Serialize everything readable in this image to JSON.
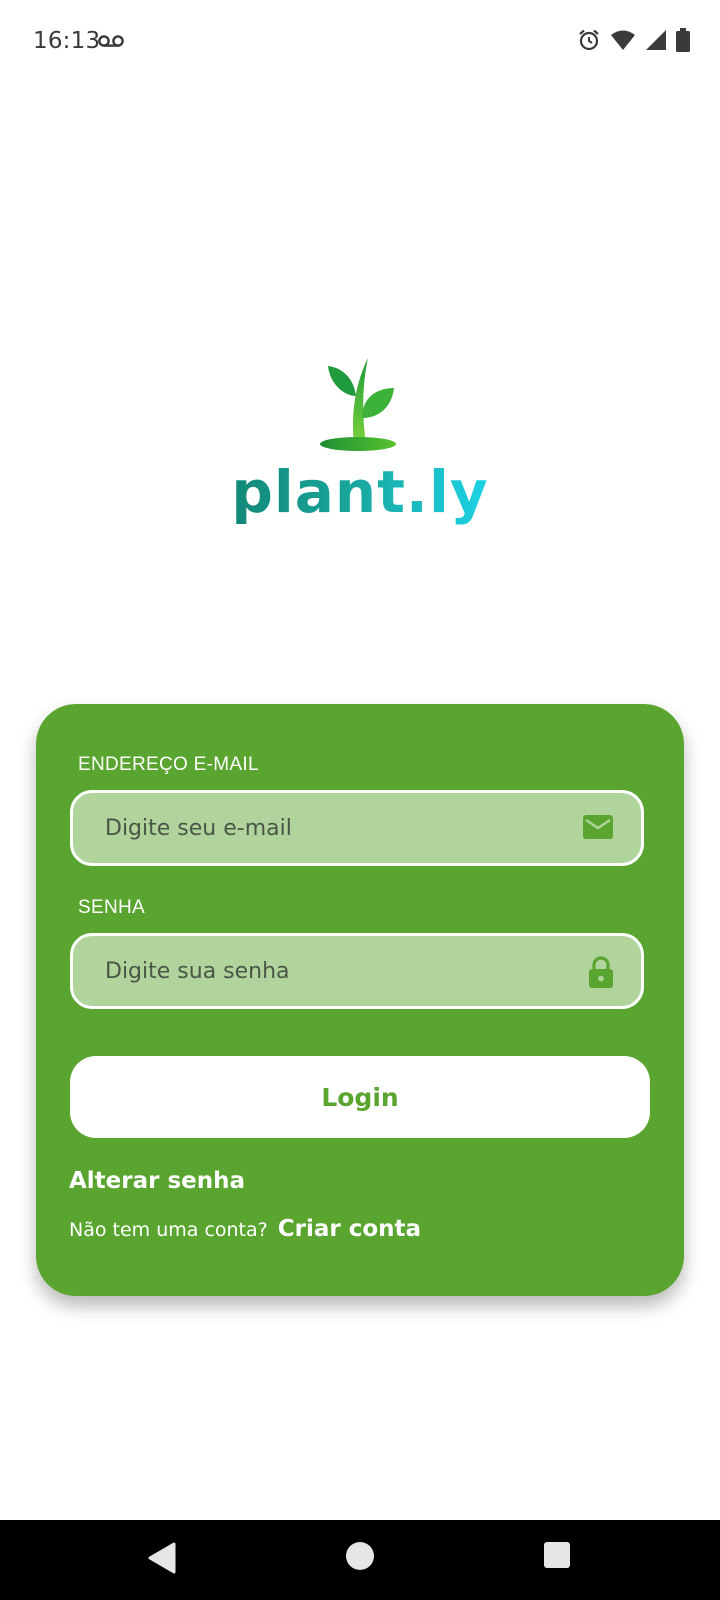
{
  "status": {
    "time": "16:13",
    "icons": [
      "voicemail-icon",
      "alarm-icon",
      "wifi-icon",
      "signal-icon",
      "battery-icon"
    ]
  },
  "logo": {
    "text": "plant.ly"
  },
  "form": {
    "email": {
      "label": "ENDEREÇO E-MAIL",
      "placeholder": "Digite seu e-mail",
      "value": "",
      "icon": "mail-icon"
    },
    "password": {
      "label": "SENHA",
      "placeholder": "Digite sua senha",
      "value": "",
      "icon": "lock-icon"
    },
    "login_label": "Login",
    "change_password_label": "Alterar senha",
    "signup_question": "Não tem uma conta?",
    "signup_label": "Criar conta"
  },
  "nav": {
    "buttons": [
      "back-icon",
      "home-icon",
      "recents-icon"
    ]
  },
  "colors": {
    "card": "#5aa52f",
    "input_bg": "#b0d49c",
    "logo_gradient_start": "#128878",
    "logo_gradient_end": "#1cd2e6"
  }
}
